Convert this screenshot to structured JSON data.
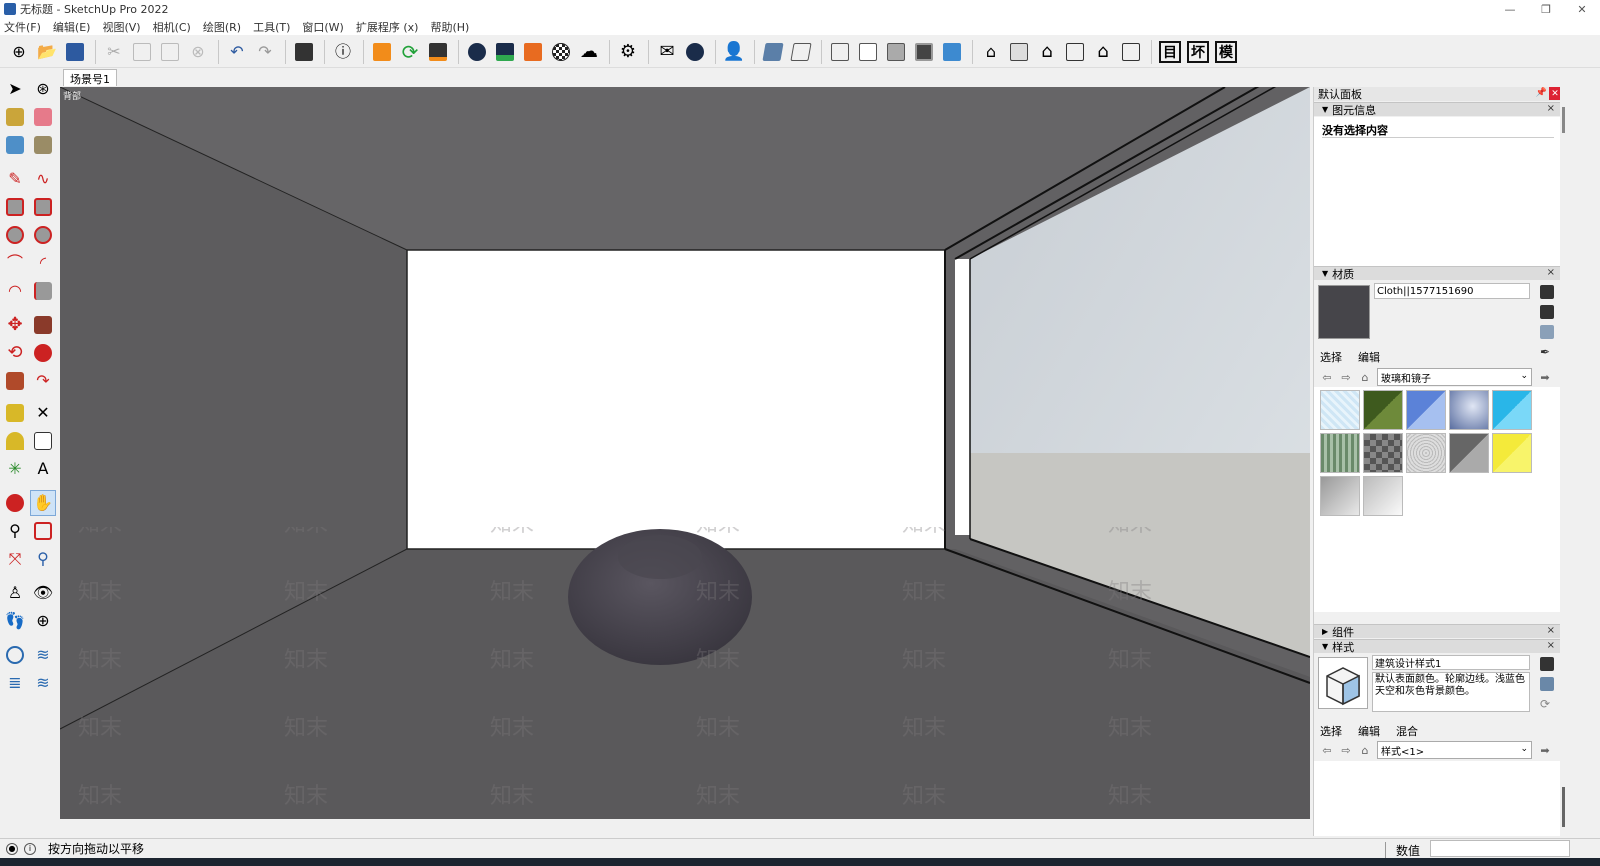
{
  "window": {
    "title": "无标题 - SketchUp Pro 2022",
    "min": "—",
    "max": "❐",
    "close": "✕"
  },
  "menu": [
    "文件(F)",
    "编辑(E)",
    "视图(V)",
    "相机(C)",
    "绘图(R)",
    "工具(T)",
    "窗口(W)",
    "扩展程序 (x)",
    "帮助(H)"
  ],
  "toolbar": {
    "text_buttons": [
      "目",
      "坏",
      "模"
    ]
  },
  "scene": {
    "tab": "场景号1",
    "view_label": "背部"
  },
  "panel": {
    "title": "默认面板",
    "entity": {
      "header": "图元信息",
      "empty": "没有选择内容"
    },
    "materials": {
      "header": "材质",
      "name": "Cloth||1577151690",
      "tab_select": "选择",
      "tab_edit": "编辑",
      "library": "玻璃和镜子",
      "swatch_color": "#46454a"
    },
    "components": {
      "header": "组件"
    },
    "styles": {
      "header": "样式",
      "name": "建筑设计样式1",
      "description": "默认表面颜色。轮廓边线。浅蓝色天空和灰色背景颜色。",
      "tab_select": "选择",
      "tab_edit": "编辑",
      "tab_mix": "混合",
      "library": "样式<1>"
    }
  },
  "status": {
    "message": "按方向拖动以平移",
    "value_label": "数值"
  }
}
